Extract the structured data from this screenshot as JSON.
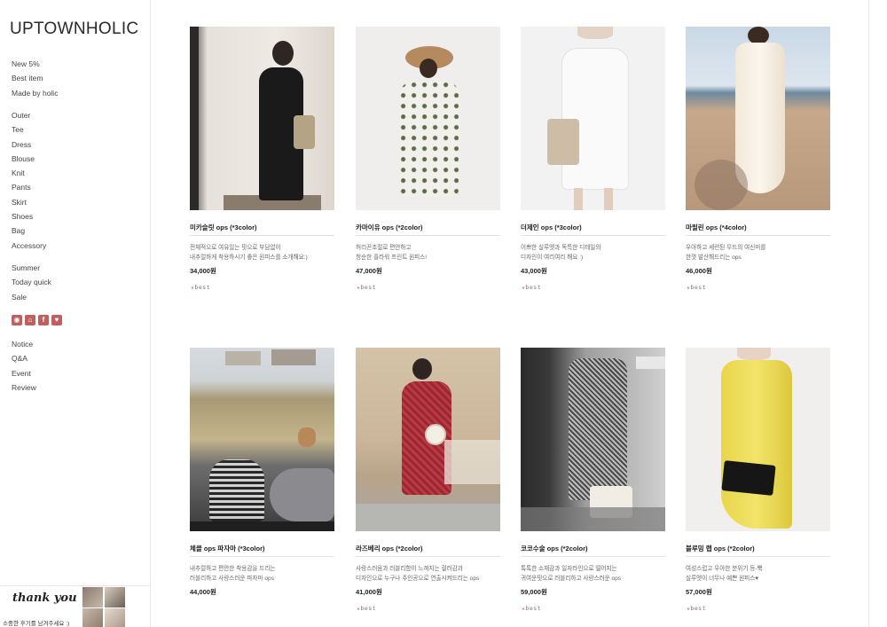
{
  "brand": "UPTOWNHOLIC",
  "nav": {
    "featured": [
      "New 5%",
      "Best item",
      "Made by holic"
    ],
    "categories": [
      "Outer",
      "Tee",
      "Dress",
      "Blouse",
      "Knit",
      "Pants",
      "Skirt",
      "Shoes",
      "Bag",
      "Accessory"
    ],
    "seasonal": [
      "Summer",
      "Today quick",
      "Sale"
    ],
    "community": [
      "Notice",
      "Q&A",
      "Event",
      "Review"
    ]
  },
  "social_icons": [
    "chat-icon",
    "store-icon",
    "facebook-icon",
    "heart-icon"
  ],
  "review_banner": {
    "script": "thank you",
    "subtitle": "소중한 후기를 남겨주세요 :)"
  },
  "badge_text": "best",
  "products": [
    {
      "name": "미카슬릿 ops (*3color)",
      "desc1": "전체적으로 여유있는 핏으로 부담없이",
      "desc2": "내추럴하게 착용하시기 좋은 원피스를 소개해요:)",
      "price": "34,000원",
      "badge": "best"
    },
    {
      "name": "카마이유 ops (*2color)",
      "desc1": "허리끈조절로 편안하고",
      "desc2": "청순한 플라워 프린트 원피스!",
      "price": "47,000원",
      "badge": "best"
    },
    {
      "name": "더제인 ops (*3color)",
      "desc1": "이쁘한 실루엣과 독특한 디테일의",
      "desc2": "디자인이 여리여리 해요 :)",
      "price": "43,000원",
      "badge": "best"
    },
    {
      "name": "마릴린 ops (*4color)",
      "desc1": "우아하고 세련된 무드의 여신미를",
      "desc2": "한껏 발산해드리는 ops",
      "price": "46,000원",
      "badge": "best"
    },
    {
      "name": "체클 ops 파자마 (*3color)",
      "desc1": "내추럴하고 편안한 착용감을 드리는",
      "desc2": "러블리하고 사랑스러운 파자마 ops",
      "price": "44,000원",
      "badge": ""
    },
    {
      "name": "라즈베리 ops (*2color)",
      "desc1": "사랑스러움과 러블리함이 느껴지는 컬러감과",
      "desc2": "디자인으로 누구나 주인공으로 연출시켜드리는 ops",
      "price": "41,000원",
      "badge": "best"
    },
    {
      "name": "코코수술 ops (*2color)",
      "desc1": "톡톡한 소재감과 일자라인으로 떨어지는",
      "desc2": "귀여운핏으로 러블리하고 사랑스러운 ops",
      "price": "59,000원",
      "badge": "best"
    },
    {
      "name": "블루밍 랩 ops (*2color)",
      "desc1": "여성스럽고 우아한 분위기 등-뿍",
      "desc2": "실루엣이 너무나 예쁜 원피스♥",
      "price": "57,000원",
      "badge": "best"
    }
  ]
}
